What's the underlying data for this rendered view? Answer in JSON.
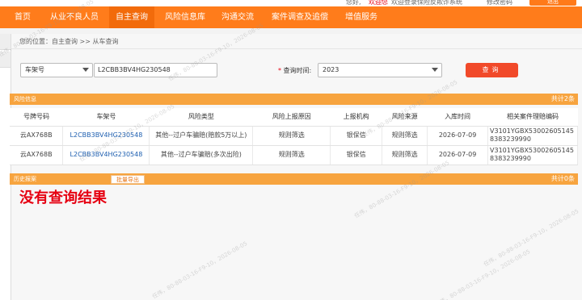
{
  "topbar": {
    "fragment1": "您好,",
    "fragment2": "欢迎您",
    "fragment3": "欢迎登录保险反欺诈系统",
    "fragment4": "修改密码",
    "fragment5": "退出"
  },
  "nav": {
    "items": [
      "首页",
      "从业不良人员",
      "自主查询",
      "风险信息库",
      "沟通交流",
      "案件调查及追偿",
      "增值服务"
    ],
    "active_index": 2
  },
  "breadcrumb": "您的位置：自主查询 >> 从车查询",
  "search": {
    "field_type": "车架号",
    "vin_value": "L2CBB3BV4HG230548",
    "time_label": "查询时间:",
    "time_required_mark": "*",
    "year_value": "2023",
    "query_button": "查询"
  },
  "risk_panel": {
    "title": "风险信息",
    "total": "共计2条",
    "columns": [
      "号牌号码",
      "车架号",
      "风险类型",
      "风险上报原因",
      "上报机构",
      "风险来源",
      "入库时间",
      "相关案件理赔编码"
    ],
    "rows": [
      [
        "云AX768B",
        "L2CBB3BV4HG230548",
        "其他--过户车骗赔(赔款5万以上)",
        "规则筛选",
        "银保信",
        "规则筛选",
        "2026-07-09",
        "V3101YGBX530026051458383239990"
      ],
      [
        "云AX768B",
        "L2CBB3BV4HG230548",
        "其他--过户车骗赔(多次出险)",
        "规则筛选",
        "银保信",
        "规则筛选",
        "2026-07-09",
        "V3101YGBX530026051458383239990"
      ]
    ]
  },
  "history_panel": {
    "title": "历史报案",
    "export_button": "批量导出",
    "total": "共计0条"
  },
  "no_result_text": "没有查询结果",
  "watermark": "任伟，80-88-03-16-F9-10，2026-08-05",
  "colors": {
    "nav": "#ff7c1b",
    "panel_header": "#f7a43f",
    "query_button": "#f14a2a",
    "link": "#1e5fb0",
    "no_result": "#e60012"
  }
}
